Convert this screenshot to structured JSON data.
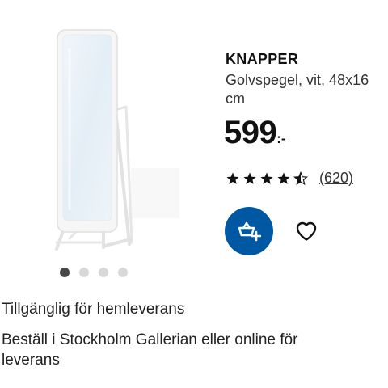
{
  "product": {
    "name": "KNAPPER",
    "description_lines": [
      "Golvspegel, vit, 48x16",
      "cm"
    ],
    "price_integer": "599",
    "price_suffix": ":-",
    "rating": 4.5,
    "rating_count": "(620)"
  },
  "carousel": {
    "total": 4,
    "active_index": 0
  },
  "actions": {
    "cart_icon": "add-to-cart-icon",
    "favorite_icon": "heart-icon"
  },
  "availability": {
    "text": "Tillgänglig för hemleverans"
  },
  "store_info": {
    "lines": [
      "Beställ i Stockholm Gallerian eller online för",
      "leverans"
    ]
  },
  "colors": {
    "brand_blue": "#0058a3",
    "text": "#111111"
  }
}
